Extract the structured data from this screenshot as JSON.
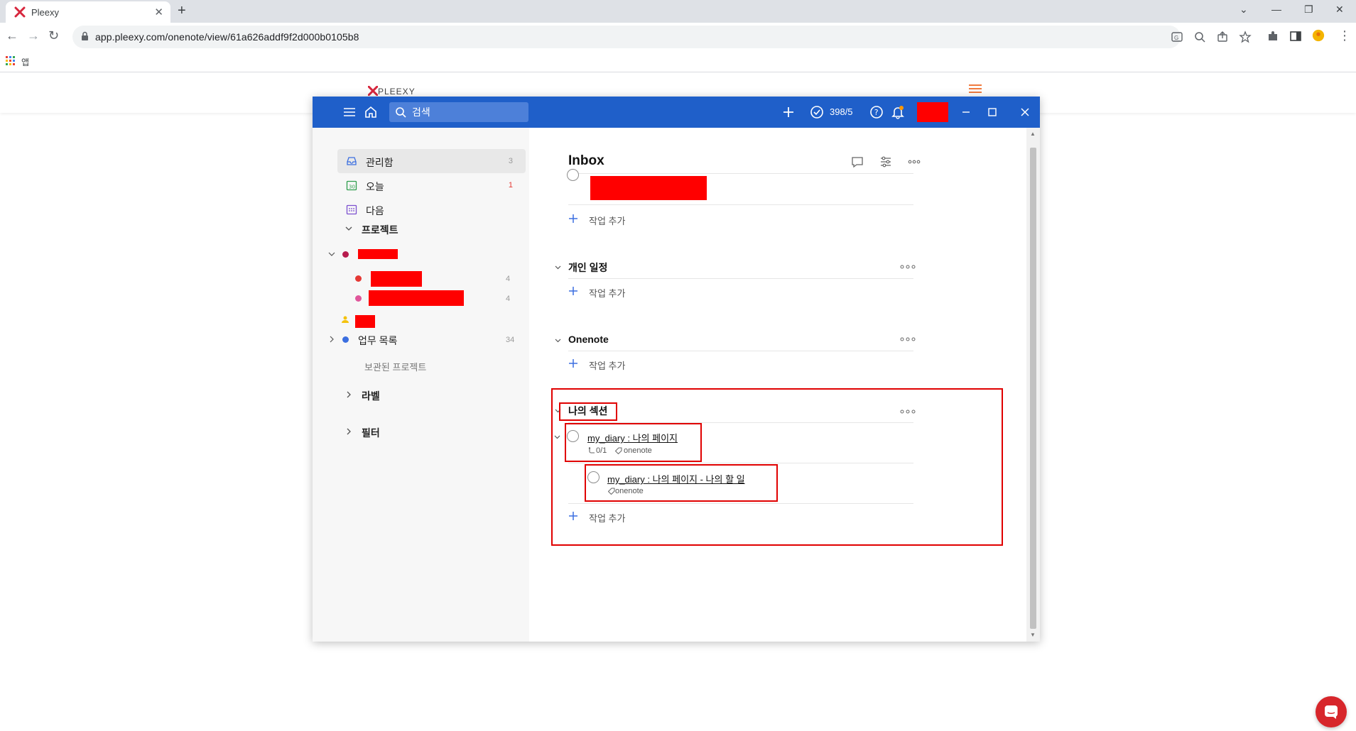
{
  "browser": {
    "tab_title": "Pleexy",
    "url": "app.pleexy.com/onenote/view/61a626addf9f2d000b0105b8",
    "bookmarks_apps_label": "앱"
  },
  "app": {
    "search_placeholder": "검색",
    "score": "398/5",
    "sidebar": {
      "items": [
        {
          "label": "관리함",
          "count": "3"
        },
        {
          "label": "오늘",
          "count": "1"
        },
        {
          "label": "다음",
          "count": ""
        }
      ],
      "projects_header": "프로젝트",
      "projects": [
        {
          "label": "",
          "count": "",
          "color": "#b71c4e"
        },
        {
          "label": "",
          "count": "4",
          "color": "#e53935"
        },
        {
          "label": "",
          "count": "4",
          "color": "#e0569b"
        },
        {
          "label": "",
          "count": "",
          "color": "#f4c20d"
        },
        {
          "label": "업무 목록",
          "count": "34",
          "color": "#3b6fe0"
        }
      ],
      "archived_projects": "보관된 프로젝트",
      "labels_header": "라벨",
      "filters_header": "필터"
    },
    "main": {
      "title": "Inbox",
      "add_task_label": "작업 추가",
      "sections": [
        {
          "name": "개인 일정"
        },
        {
          "name": "Onenote"
        },
        {
          "name": "나의 섹션"
        }
      ],
      "tasks": [
        {
          "title": "my_diary : 나의 페이지",
          "subtasks": "0/1",
          "label": "onenote"
        },
        {
          "title": "my_diary : 나의 페이지 - 나의 할 일",
          "label": "onenote"
        }
      ]
    }
  },
  "colors": {
    "header_blue": "#1f5fc9",
    "highlight_red": "#e00000"
  }
}
